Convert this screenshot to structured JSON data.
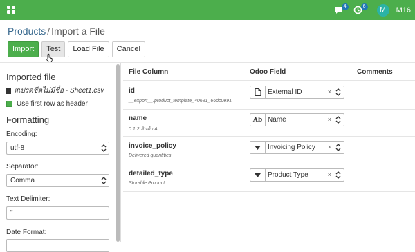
{
  "navbar": {
    "messages_count": "4",
    "activities_count": "6",
    "avatar_letter": "M",
    "user_name": "M16"
  },
  "breadcrumb": {
    "parent": "Products",
    "separator": "/",
    "current": "Import a File"
  },
  "toolbar": {
    "import_label": "Import",
    "test_label": "Test",
    "load_file_label": "Load File",
    "cancel_label": "Cancel"
  },
  "left": {
    "imported_file_title": "Imported file",
    "file_name": "สเปรดชีตไม่มีชื่อ - Sheet1.csv",
    "first_row_header_label": "Use first row as header",
    "formatting_title": "Formatting",
    "encoding_label": "Encoding:",
    "encoding_value": "utf-8",
    "separator_label": "Separator:",
    "separator_value": "Comma",
    "text_delimiter_label": "Text Delimiter:",
    "text_delimiter_value": "\"",
    "date_format_label": "Date Format:"
  },
  "table": {
    "headers": {
      "file_column": "File Column",
      "odoo_field": "Odoo Field",
      "comments": "Comments"
    },
    "rows": [
      {
        "name": "id",
        "sub": "__export__.product_template_40631_66dc0e91",
        "field_icon": "document-icon",
        "field": "External ID"
      },
      {
        "name": "name",
        "sub": "0.1.2 สินค้า A",
        "field_icon": "Ab",
        "field": "Name"
      },
      {
        "name": "invoice_policy",
        "sub": "Delivered quantities",
        "field_icon": "caret-down-icon",
        "field": "Invoicing Policy"
      },
      {
        "name": "detailed_type",
        "sub": "Storable Product",
        "field_icon": "caret-down-icon",
        "field": "Product Type"
      }
    ],
    "clear_symbol": "×"
  },
  "colors": {
    "brand": "#4cae4c",
    "link": "#3a6a8f",
    "badge": "#1f78b4",
    "avatar": "#2bb3a6"
  }
}
